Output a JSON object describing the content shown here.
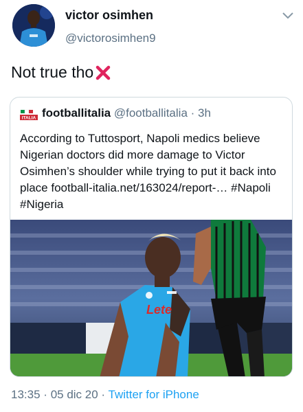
{
  "author": {
    "display_name": "victor osimhen",
    "handle": "@victorosimhen9"
  },
  "tweet": {
    "text": "Not true tho",
    "emoji": "cross-mark-icon"
  },
  "quoted_tweet": {
    "name": "footballitalia",
    "handle": "@footballitalia",
    "separator": "·",
    "time": "3h",
    "text": "According to Tuttosport, Napoli medics believe Nigerian doctors did more damage to Victor Osimhen’s shoulder while trying to put it back into place football-italia.net/163024/report-… #Napoli #Nigeria",
    "logo_text": "ITALIA",
    "jersey_text": "Lete"
  },
  "footer": {
    "time": "13:35",
    "separator": "·",
    "date": "05 dic 20",
    "source": "Twitter for iPhone"
  },
  "colors": {
    "secondary_text": "#5b7083",
    "link": "#1da1f2",
    "cross": "#e0245e",
    "napoli_blue": "#2aa7e6",
    "sassuolo_green": "#0f7a3c"
  }
}
